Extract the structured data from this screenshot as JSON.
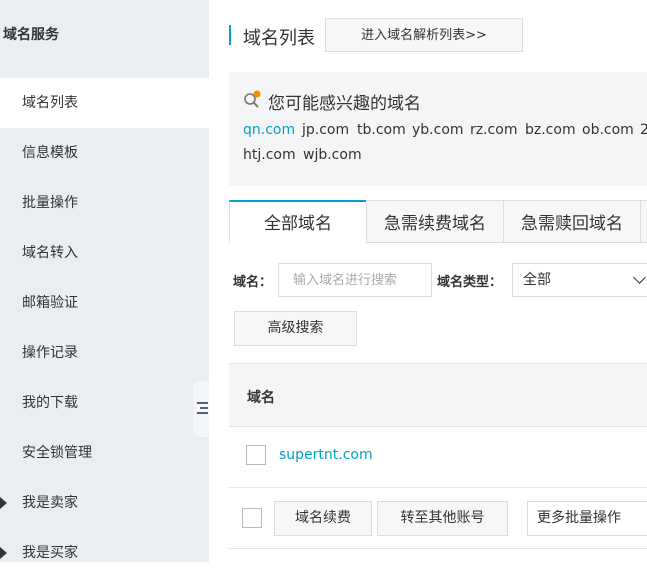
{
  "sidebar": {
    "title": "域名服务",
    "items": [
      {
        "label": "域名列表"
      },
      {
        "label": "信息模板"
      },
      {
        "label": "批量操作"
      },
      {
        "label": "域名转入"
      },
      {
        "label": "邮箱验证"
      },
      {
        "label": "操作记录"
      },
      {
        "label": "我的下载"
      },
      {
        "label": "安全锁管理"
      },
      {
        "label": "我是卖家"
      },
      {
        "label": "我是买家"
      }
    ]
  },
  "header": {
    "title": "域名列表",
    "goto_button": "进入域名解析列表>>"
  },
  "interest": {
    "title": "您可能感兴趣的域名",
    "domains": [
      "qn.com",
      "jp.com",
      "tb.com",
      "yb.com",
      "rz.com",
      "bz.com",
      "ob.com",
      "2",
      "htj.com",
      "wjb.com"
    ]
  },
  "tabs": [
    "全部域名",
    "急需续费域名",
    "急需赎回域名"
  ],
  "filters": {
    "domain_label": "域名：",
    "domain_placeholder": "输入域名进行搜索",
    "type_label": "域名类型：",
    "type_value": "全部",
    "advanced_button": "高级搜索"
  },
  "table": {
    "columns": [
      "域名"
    ],
    "rows": [
      {
        "domain": "supertnt.com"
      }
    ]
  },
  "bulk_actions": {
    "renew_button": "域名续费",
    "transfer_button": "转至其他账号",
    "more_select": "更多批量操作"
  },
  "colors": {
    "accent": "#00a2ca",
    "sidebar_bg": "#eaedf1"
  }
}
